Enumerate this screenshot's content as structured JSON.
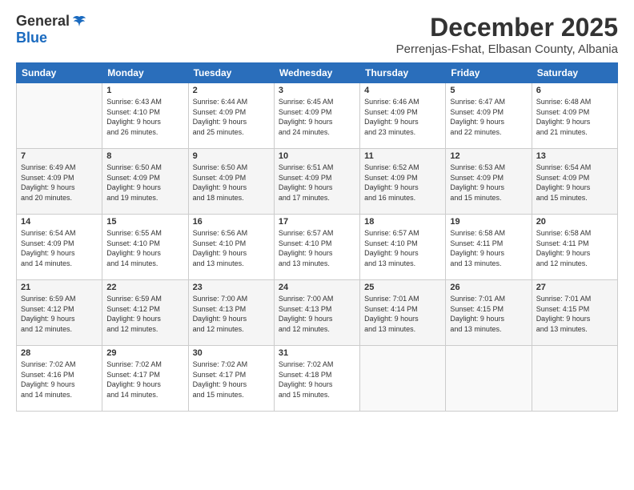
{
  "header": {
    "logo": {
      "general": "General",
      "blue": "Blue"
    },
    "title": "December 2025",
    "location": "Perrenjas-Fshat, Elbasan County, Albania"
  },
  "calendar": {
    "days_of_week": [
      "Sunday",
      "Monday",
      "Tuesday",
      "Wednesday",
      "Thursday",
      "Friday",
      "Saturday"
    ],
    "weeks": [
      [
        {
          "day": "",
          "info": ""
        },
        {
          "day": "1",
          "info": "Sunrise: 6:43 AM\nSunset: 4:10 PM\nDaylight: 9 hours\nand 26 minutes."
        },
        {
          "day": "2",
          "info": "Sunrise: 6:44 AM\nSunset: 4:09 PM\nDaylight: 9 hours\nand 25 minutes."
        },
        {
          "day": "3",
          "info": "Sunrise: 6:45 AM\nSunset: 4:09 PM\nDaylight: 9 hours\nand 24 minutes."
        },
        {
          "day": "4",
          "info": "Sunrise: 6:46 AM\nSunset: 4:09 PM\nDaylight: 9 hours\nand 23 minutes."
        },
        {
          "day": "5",
          "info": "Sunrise: 6:47 AM\nSunset: 4:09 PM\nDaylight: 9 hours\nand 22 minutes."
        },
        {
          "day": "6",
          "info": "Sunrise: 6:48 AM\nSunset: 4:09 PM\nDaylight: 9 hours\nand 21 minutes."
        }
      ],
      [
        {
          "day": "7",
          "info": "Sunrise: 6:49 AM\nSunset: 4:09 PM\nDaylight: 9 hours\nand 20 minutes."
        },
        {
          "day": "8",
          "info": "Sunrise: 6:50 AM\nSunset: 4:09 PM\nDaylight: 9 hours\nand 19 minutes."
        },
        {
          "day": "9",
          "info": "Sunrise: 6:50 AM\nSunset: 4:09 PM\nDaylight: 9 hours\nand 18 minutes."
        },
        {
          "day": "10",
          "info": "Sunrise: 6:51 AM\nSunset: 4:09 PM\nDaylight: 9 hours\nand 17 minutes."
        },
        {
          "day": "11",
          "info": "Sunrise: 6:52 AM\nSunset: 4:09 PM\nDaylight: 9 hours\nand 16 minutes."
        },
        {
          "day": "12",
          "info": "Sunrise: 6:53 AM\nSunset: 4:09 PM\nDaylight: 9 hours\nand 15 minutes."
        },
        {
          "day": "13",
          "info": "Sunrise: 6:54 AM\nSunset: 4:09 PM\nDaylight: 9 hours\nand 15 minutes."
        }
      ],
      [
        {
          "day": "14",
          "info": "Sunrise: 6:54 AM\nSunset: 4:09 PM\nDaylight: 9 hours\nand 14 minutes."
        },
        {
          "day": "15",
          "info": "Sunrise: 6:55 AM\nSunset: 4:10 PM\nDaylight: 9 hours\nand 14 minutes."
        },
        {
          "day": "16",
          "info": "Sunrise: 6:56 AM\nSunset: 4:10 PM\nDaylight: 9 hours\nand 13 minutes."
        },
        {
          "day": "17",
          "info": "Sunrise: 6:57 AM\nSunset: 4:10 PM\nDaylight: 9 hours\nand 13 minutes."
        },
        {
          "day": "18",
          "info": "Sunrise: 6:57 AM\nSunset: 4:10 PM\nDaylight: 9 hours\nand 13 minutes."
        },
        {
          "day": "19",
          "info": "Sunrise: 6:58 AM\nSunset: 4:11 PM\nDaylight: 9 hours\nand 13 minutes."
        },
        {
          "day": "20",
          "info": "Sunrise: 6:58 AM\nSunset: 4:11 PM\nDaylight: 9 hours\nand 12 minutes."
        }
      ],
      [
        {
          "day": "21",
          "info": "Sunrise: 6:59 AM\nSunset: 4:12 PM\nDaylight: 9 hours\nand 12 minutes."
        },
        {
          "day": "22",
          "info": "Sunrise: 6:59 AM\nSunset: 4:12 PM\nDaylight: 9 hours\nand 12 minutes."
        },
        {
          "day": "23",
          "info": "Sunrise: 7:00 AM\nSunset: 4:13 PM\nDaylight: 9 hours\nand 12 minutes."
        },
        {
          "day": "24",
          "info": "Sunrise: 7:00 AM\nSunset: 4:13 PM\nDaylight: 9 hours\nand 12 minutes."
        },
        {
          "day": "25",
          "info": "Sunrise: 7:01 AM\nSunset: 4:14 PM\nDaylight: 9 hours\nand 13 minutes."
        },
        {
          "day": "26",
          "info": "Sunrise: 7:01 AM\nSunset: 4:15 PM\nDaylight: 9 hours\nand 13 minutes."
        },
        {
          "day": "27",
          "info": "Sunrise: 7:01 AM\nSunset: 4:15 PM\nDaylight: 9 hours\nand 13 minutes."
        }
      ],
      [
        {
          "day": "28",
          "info": "Sunrise: 7:02 AM\nSunset: 4:16 PM\nDaylight: 9 hours\nand 14 minutes."
        },
        {
          "day": "29",
          "info": "Sunrise: 7:02 AM\nSunset: 4:17 PM\nDaylight: 9 hours\nand 14 minutes."
        },
        {
          "day": "30",
          "info": "Sunrise: 7:02 AM\nSunset: 4:17 PM\nDaylight: 9 hours\nand 15 minutes."
        },
        {
          "day": "31",
          "info": "Sunrise: 7:02 AM\nSunset: 4:18 PM\nDaylight: 9 hours\nand 15 minutes."
        },
        {
          "day": "",
          "info": ""
        },
        {
          "day": "",
          "info": ""
        },
        {
          "day": "",
          "info": ""
        }
      ]
    ]
  }
}
